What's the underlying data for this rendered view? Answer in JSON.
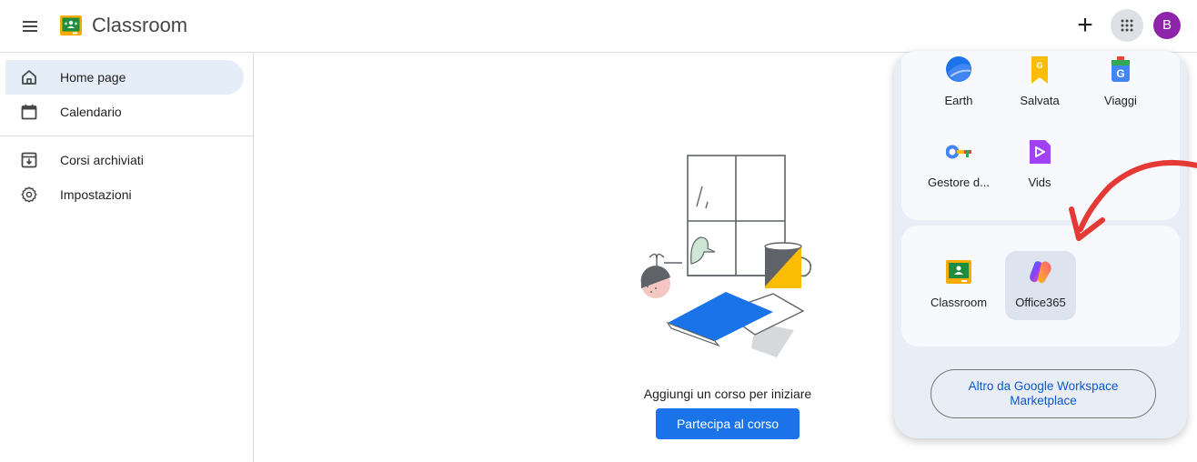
{
  "header": {
    "title": "Classroom",
    "menu_icon": "hamburger-menu-icon",
    "add_icon": "plus-icon",
    "apps_icon": "apps-grid-icon",
    "avatar_letter": "B",
    "avatar_color": "#8e24aa"
  },
  "sidebar": {
    "items": [
      {
        "label": "Home page",
        "icon": "home-icon",
        "active": true
      },
      {
        "label": "Calendario",
        "icon": "calendar-icon"
      },
      {
        "label": "Corsi archiviati",
        "icon": "archive-icon"
      },
      {
        "label": "Impostazioni",
        "icon": "settings-icon"
      }
    ]
  },
  "main": {
    "empty_message": "Aggiungi un corso per iniziare",
    "join_button": "Partecipa al corso",
    "accent": "#1a73e8"
  },
  "apps_panel": {
    "top_apps": [
      {
        "label": "Earth",
        "icon": "earth-icon"
      },
      {
        "label": "Salvata",
        "icon": "saved-bookmark-icon"
      },
      {
        "label": "Viaggi",
        "icon": "travel-icon"
      },
      {
        "label": "Gestore d...",
        "icon": "password-manager-key-icon"
      },
      {
        "label": "Vids",
        "icon": "vids-icon"
      }
    ],
    "bottom_apps": [
      {
        "label": "Classroom",
        "icon": "classroom-icon"
      },
      {
        "label": "Office365",
        "icon": "office365-icon"
      }
    ],
    "marketplace_line1": "Altro da Google Workspace",
    "marketplace_line2": "Marketplace"
  }
}
